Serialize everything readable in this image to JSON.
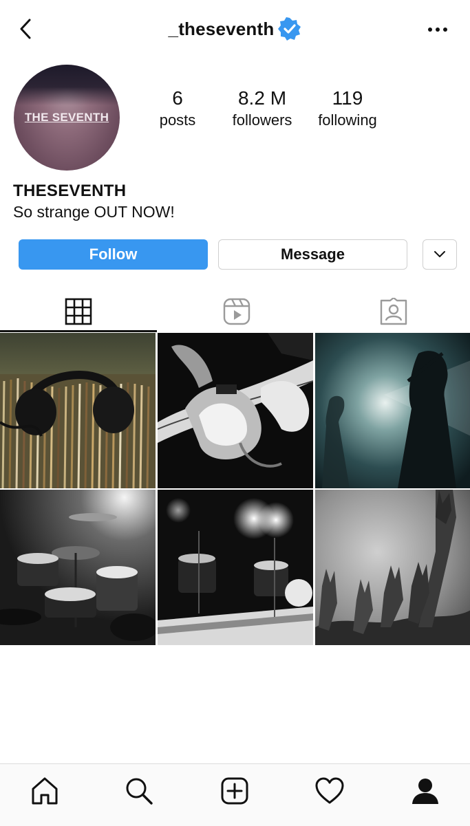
{
  "header": {
    "username": "_theseventh",
    "verified": true,
    "icons": [
      "back-arrow-icon",
      "verified-badge-icon",
      "more-options-icon"
    ]
  },
  "profile": {
    "avatar_text": "THE SEVENTH",
    "display_name": "THESEVENTH",
    "bio": "So strange OUT NOW!",
    "stats": [
      {
        "value": "6",
        "label": "posts"
      },
      {
        "value": "8.2 M",
        "label": "followers"
      },
      {
        "value": "119",
        "label": "following"
      }
    ]
  },
  "actions": {
    "follow_label": "Follow",
    "message_label": "Message",
    "more_icon": "chevron-down-icon"
  },
  "tabs": [
    {
      "icon": "grid-icon",
      "active": true
    },
    {
      "icon": "reels-icon",
      "active": false
    },
    {
      "icon": "tagged-icon",
      "active": false
    }
  ],
  "posts": [
    {
      "subject": "headphones on vinyl records"
    },
    {
      "subject": "guitarist playing electric guitar"
    },
    {
      "subject": "band silhouettes on stage"
    },
    {
      "subject": "drum kit"
    },
    {
      "subject": "stage with drum kit and lights"
    },
    {
      "subject": "crowd hands raised"
    }
  ],
  "bottom_nav": [
    {
      "icon": "home-icon"
    },
    {
      "icon": "search-icon"
    },
    {
      "icon": "new-post-icon"
    },
    {
      "icon": "activity-heart-icon"
    },
    {
      "icon": "profile-icon"
    }
  ],
  "colors": {
    "accent": "#3897f0",
    "verified": "#3897f0",
    "text": "#111111",
    "border": "#cfcfcf"
  }
}
